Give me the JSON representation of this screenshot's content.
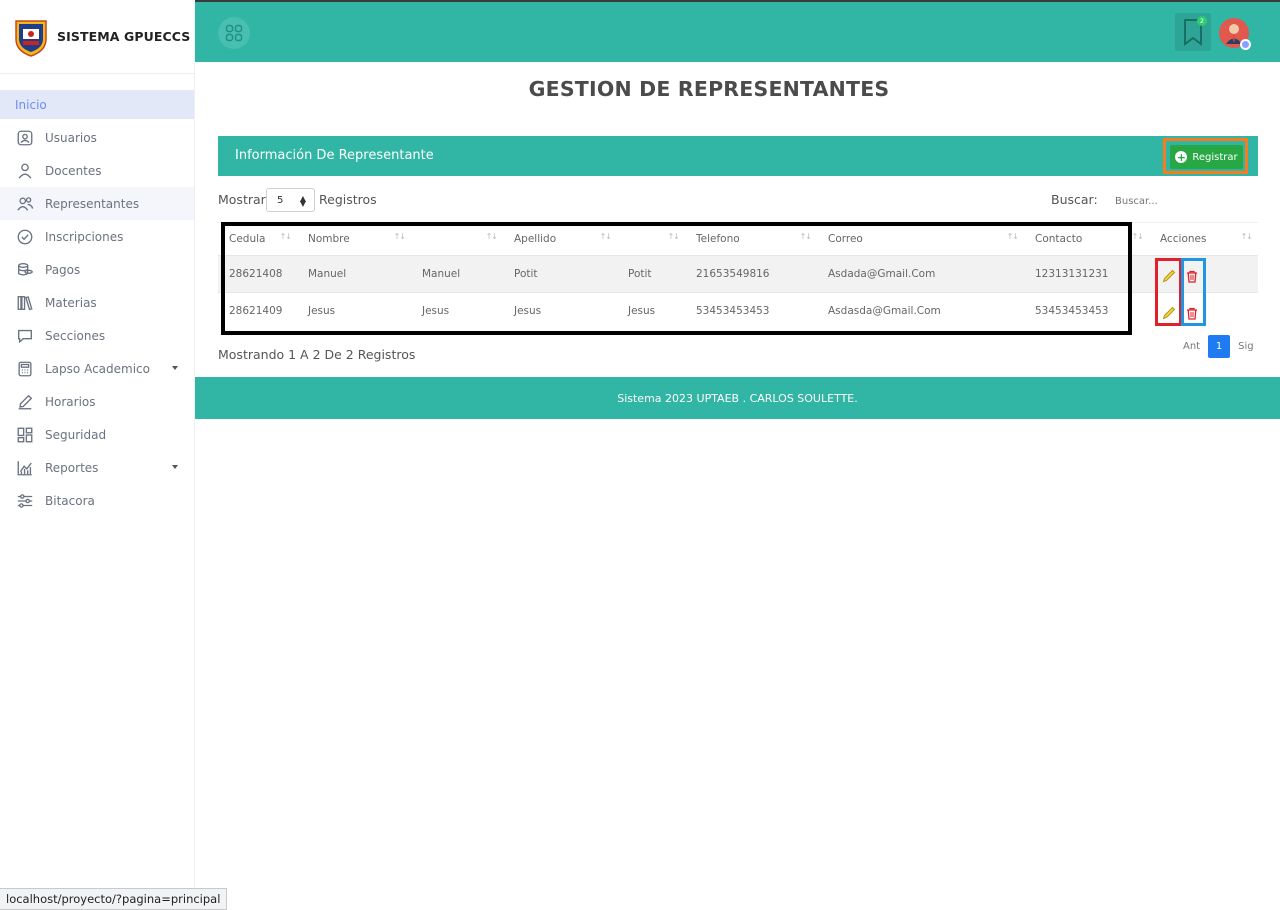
{
  "app": {
    "brand": "SISTEMA GPUECCS"
  },
  "sidebar": {
    "items": [
      {
        "label": "Inicio",
        "icon": "home"
      },
      {
        "label": "Usuarios",
        "icon": "user-badge-icon"
      },
      {
        "label": "Docentes",
        "icon": "person-icon"
      },
      {
        "label": "Representantes",
        "icon": "people-icon"
      },
      {
        "label": "Inscripciones",
        "icon": "check-circle-icon"
      },
      {
        "label": "Pagos",
        "icon": "coins-icon"
      },
      {
        "label": "Materias",
        "icon": "books-icon"
      },
      {
        "label": "Secciones",
        "icon": "chat-icon"
      },
      {
        "label": "Lapso Academico",
        "icon": "calculator-icon"
      },
      {
        "label": "Horarios",
        "icon": "edit-icon"
      },
      {
        "label": "Seguridad",
        "icon": "dashboard-icon"
      },
      {
        "label": "Reportes",
        "icon": "chart-icon"
      },
      {
        "label": "Bitacora",
        "icon": "sliders-icon"
      }
    ]
  },
  "topbar": {
    "notification_count": "2"
  },
  "page": {
    "title": "GESTION DE REPRESENTANTES"
  },
  "card": {
    "title": "Información De Representante",
    "register_label": "Registrar"
  },
  "controls": {
    "show_label": "Mostrar",
    "page_size": "5",
    "records_label": "Registros",
    "search_label": "Buscar:",
    "search_placeholder": "Buscar..."
  },
  "table": {
    "headers": [
      "Cedula",
      "Nombre",
      "",
      "Apellido",
      "",
      "Telefono",
      "Correo",
      "Contacto",
      "Acciones"
    ],
    "rows": [
      [
        "28621408",
        "Manuel",
        "Manuel",
        "Potit",
        "Potit",
        "21653549816",
        "Asdada@Gmail.Com",
        "12313131231"
      ],
      [
        "28621409",
        "Jesus",
        "Jesus",
        "Jesus",
        "Jesus",
        "53453453453",
        "Asdasda@Gmail.Com",
        "53453453453"
      ]
    ]
  },
  "pagination": {
    "info": "Mostrando 1 A 2 De 2 Registros",
    "prev": "Ant",
    "current": "1",
    "next": "Sig"
  },
  "footer": {
    "text": "Sistema 2023 UPTAEB . CARLOS SOULETTE."
  },
  "status_bar": {
    "url": "localhost/proyecto/?pagina=principal"
  },
  "colors": {
    "primary": "#31b5a4",
    "register": "#27a844",
    "pager_active": "#1e7bf2",
    "sidebar_active_bg": "#e3e8f9",
    "sidebar_active_text": "#6c8cf0"
  }
}
